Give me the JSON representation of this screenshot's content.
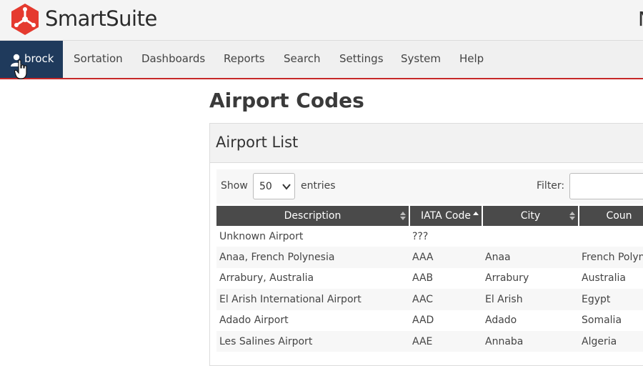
{
  "app": {
    "brand": "SmartSuite",
    "top_right_text": "N",
    "accent_color": "#c62828",
    "nav_active_color": "#1f3a5c"
  },
  "nav": {
    "user_label": "brock",
    "items": [
      {
        "label": "Sortation"
      },
      {
        "label": "Dashboards"
      },
      {
        "label": "Reports"
      },
      {
        "label": "Search"
      },
      {
        "label": "Settings"
      },
      {
        "label": "System"
      },
      {
        "label": "Help"
      }
    ]
  },
  "page": {
    "title": "Airport Codes"
  },
  "panel": {
    "title": "Airport List",
    "show_label": "Show",
    "page_size": "50",
    "entries_label": "entries",
    "filter_label": "Filter:",
    "filter_value": ""
  },
  "table": {
    "columns": [
      "Description",
      "IATA Code",
      "City",
      "Coun"
    ],
    "rows": [
      [
        "Unknown Airport",
        "???",
        "",
        ""
      ],
      [
        "Anaa, French Polynesia",
        "AAA",
        "Anaa",
        "French Polyn"
      ],
      [
        "Arrabury, Australia",
        "AAB",
        "Arrabury",
        "Australia"
      ],
      [
        "El Arish International Airport",
        "AAC",
        "El Arish",
        "Egypt"
      ],
      [
        "Adado Airport",
        "AAD",
        "Adado",
        "Somalia"
      ],
      [
        "Les Salines Airport",
        "AAE",
        "Annaba",
        "Algeria"
      ]
    ]
  }
}
